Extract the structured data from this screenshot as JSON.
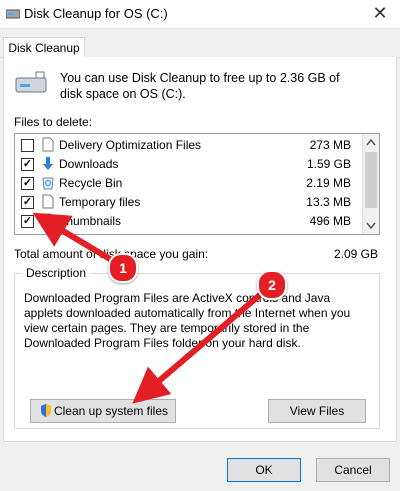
{
  "window": {
    "title": "Disk Cleanup for OS (C:)",
    "close_glyph": "✕"
  },
  "tab": {
    "label": "Disk Cleanup"
  },
  "intro": {
    "text": "You can use Disk Cleanup to free up to 2.36 GB of disk space on OS (C:)."
  },
  "files_label": "Files to delete:",
  "files": [
    {
      "name": "Delivery Optimization Files",
      "size": "273 MB",
      "checked": false,
      "icon": "file-icon"
    },
    {
      "name": "Downloads",
      "size": "1.59 GB",
      "checked": true,
      "icon": "download-arrow-icon"
    },
    {
      "name": "Recycle Bin",
      "size": "2.19 MB",
      "checked": true,
      "icon": "recycle-bin-icon"
    },
    {
      "name": "Temporary files",
      "size": "13.3 MB",
      "checked": true,
      "icon": "file-icon"
    },
    {
      "name": "Thumbnails",
      "size": "496 MB",
      "checked": true,
      "icon": "file-icon"
    }
  ],
  "total": {
    "label": "Total amount of disk space you gain:",
    "value": "2.09 GB"
  },
  "description": {
    "label": "Description",
    "text": "Downloaded Program Files are ActiveX controls and Java applets downloaded automatically from the Internet when you view certain pages. They are temporarily stored in the Downloaded Program Files folder on your hard disk."
  },
  "buttons": {
    "clean_system": "Clean up system files",
    "view_files": "View Files",
    "ok": "OK",
    "cancel": "Cancel"
  },
  "annotations": {
    "marker1": "1",
    "marker2": "2",
    "color": "#e31e24"
  }
}
